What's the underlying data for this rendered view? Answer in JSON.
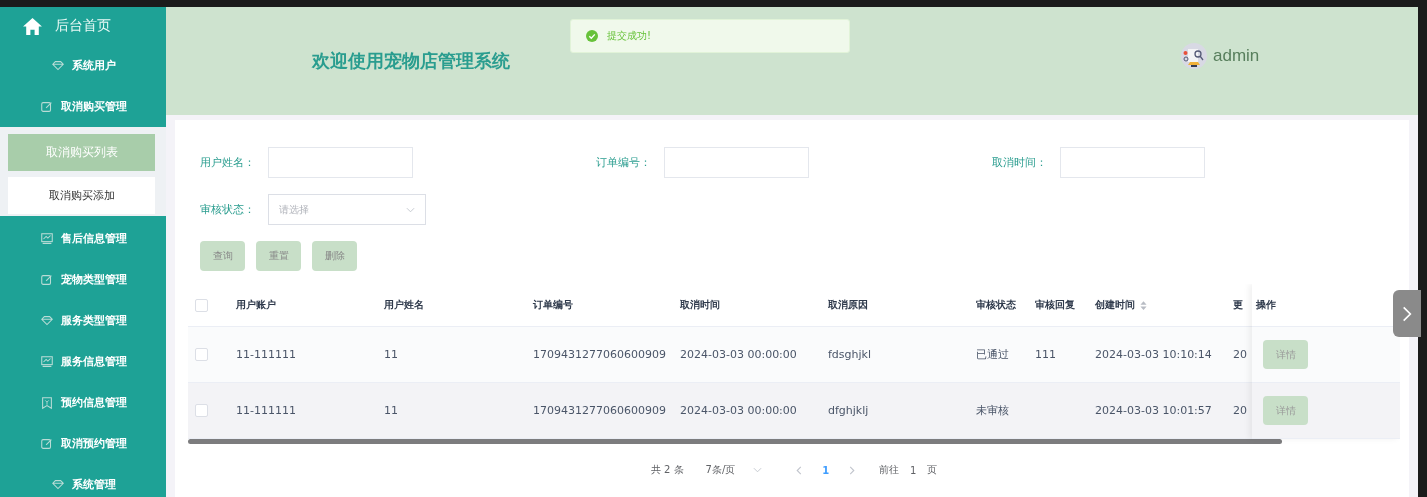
{
  "sidebar": {
    "home": {
      "label": "后台首页"
    },
    "items": [
      {
        "label": "系统用户"
      },
      {
        "label": "取消购买管理",
        "children": [
          {
            "label": "取消购买列表",
            "selected": true
          },
          {
            "label": "取消购买添加",
            "selected": false
          }
        ]
      },
      {
        "label": "售后信息管理"
      },
      {
        "label": "宠物类型管理"
      },
      {
        "label": "服务类型管理"
      },
      {
        "label": "服务信息管理"
      },
      {
        "label": "预约信息管理"
      },
      {
        "label": "取消预约管理"
      },
      {
        "label": "系统管理"
      }
    ]
  },
  "header": {
    "title": "欢迎使用宠物店管理系统",
    "toast": {
      "message": "提交成功!"
    },
    "user": {
      "name": "admin"
    }
  },
  "filters": [
    {
      "label": "用户姓名：",
      "kind": "text"
    },
    {
      "label": "订单编号：",
      "kind": "text"
    },
    {
      "label": "取消时间：",
      "kind": "text"
    },
    {
      "label": "审核状态：",
      "kind": "select",
      "placeholder": "请选择"
    }
  ],
  "buttons": [
    "查询",
    "重置",
    "删除"
  ],
  "table": {
    "select_all": {
      "checked": false
    },
    "columns": [
      {
        "label": "用户账户"
      },
      {
        "label": "用户姓名"
      },
      {
        "label": "订单编号"
      },
      {
        "label": "取消时间"
      },
      {
        "label": "取消原因"
      },
      {
        "label": "审核状态"
      },
      {
        "label": "审核回复"
      },
      {
        "label": "创建时间",
        "sortable": true
      },
      {
        "label": "更"
      }
    ],
    "action_column": "操作",
    "rows": [
      {
        "checked": false,
        "cells": [
          "11-111111",
          "11",
          "1709431277060600909",
          "2024-03-03 00:00:00",
          "fdsghjkl",
          "已通过",
          "111",
          "2024-03-03 10:10:14",
          "20"
        ],
        "action": "详情"
      },
      {
        "checked": false,
        "cells": [
          "11-111111",
          "11",
          "1709431277060600909",
          "2024-03-03 00:00:00",
          "dfghjklj",
          "未审核",
          null,
          "2024-03-03 10:01:57",
          "20"
        ],
        "action": "详情"
      }
    ]
  },
  "pagination": {
    "total": "共 2 条",
    "page_size": "7条/页",
    "pages": [
      {
        "label": "1",
        "selected": true
      }
    ],
    "goto_label": "前往",
    "goto_value": "1",
    "page_suffix": "页"
  }
}
